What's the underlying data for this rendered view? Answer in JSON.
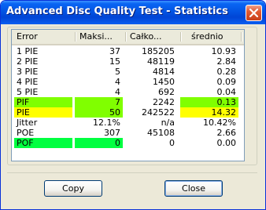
{
  "window": {
    "title": "Advanced Disc Quality Test - Statistics"
  },
  "table": {
    "columns": [
      "Error",
      "Maksi...",
      "Całko...",
      "średnio"
    ],
    "rows": [
      {
        "name": "1 PIE",
        "max": "37",
        "total": "185205",
        "avg": "10.93",
        "name_bg": "",
        "max_bg": "",
        "avg_bg": ""
      },
      {
        "name": "2 PIE",
        "max": "15",
        "total": "48119",
        "avg": "2.84",
        "name_bg": "",
        "max_bg": "",
        "avg_bg": ""
      },
      {
        "name": "3 PIE",
        "max": "5",
        "total": "4814",
        "avg": "0.28",
        "name_bg": "",
        "max_bg": "",
        "avg_bg": ""
      },
      {
        "name": "4 PIE",
        "max": "4",
        "total": "1450",
        "avg": "0.09",
        "name_bg": "",
        "max_bg": "",
        "avg_bg": ""
      },
      {
        "name": "5 PIE",
        "max": "4",
        "total": "692",
        "avg": "0.04",
        "name_bg": "",
        "max_bg": "",
        "avg_bg": ""
      },
      {
        "name": "PIF",
        "max": "7",
        "total": "2242",
        "avg": "0.13",
        "name_bg": "#80ff00",
        "max_bg": "#80ff00",
        "avg_bg": "#80ff00"
      },
      {
        "name": "PIE",
        "max": "50",
        "total": "242522",
        "avg": "14.32",
        "name_bg": "#ffff00",
        "max_bg": "#80ff00",
        "avg_bg": "#ffff00"
      },
      {
        "name": "Jitter",
        "max": "12.1%",
        "total": "n/a",
        "avg": "10.42%",
        "name_bg": "",
        "max_bg": "",
        "avg_bg": ""
      },
      {
        "name": "POE",
        "max": "307",
        "total": "45108",
        "avg": "2.66",
        "name_bg": "",
        "max_bg": "",
        "avg_bg": ""
      },
      {
        "name": "POF",
        "max": "0",
        "total": "0",
        "avg": "0.00",
        "name_bg": "#00ff40",
        "max_bg": "#00ff40",
        "avg_bg": ""
      }
    ]
  },
  "buttons": {
    "copy": "Copy",
    "close": "Close"
  },
  "colors": {
    "titlebar": "#0054e3",
    "highlight_green": "#80ff00",
    "highlight_yellow": "#ffff00",
    "highlight_bright_green": "#00ff40"
  }
}
